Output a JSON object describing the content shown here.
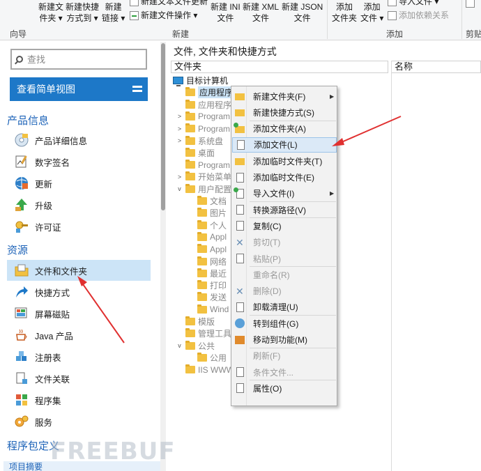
{
  "ribbon": {
    "buttons": [
      {
        "l1": "新建文",
        "l2": "件夹 ▾"
      },
      {
        "l1": "新建快捷",
        "l2": "方式到 ▾"
      },
      {
        "l1": "新建",
        "l2": "链接 ▾"
      },
      {
        "l1": "新建 INI",
        "l2": "文件"
      },
      {
        "l1": "新建 XML",
        "l2": "文件"
      },
      {
        "l1": "新建 JSON",
        "l2": "文件"
      },
      {
        "l1": "添加",
        "l2": "文件夹"
      },
      {
        "l1": "添加",
        "l2": "文件 ▾"
      }
    ],
    "small_top_cut": "新建文本文件更新",
    "new_file_ops": "新建文件操作 ▾",
    "import_file": "导入文件 ▾",
    "add_dependency": "添加依赖关系",
    "group_guide": "向导",
    "group_new": "新建",
    "group_add": "添加",
    "group_clip": "剪贴"
  },
  "sidebar": {
    "search_placeholder": "查找",
    "simple_view": "查看简单视图",
    "section_product": "产品信息",
    "product_items": [
      "产品详细信息",
      "数字签名",
      "更新",
      "升级",
      "许可证"
    ],
    "section_resources": "资源",
    "resource_items": [
      "文件和文件夹",
      "快捷方式",
      "屏幕磁贴",
      "Java 产品",
      "注册表",
      "文件关联",
      "程序集",
      "服务"
    ],
    "section_package": "程序包定义",
    "bottom_item": "项目摘要"
  },
  "main": {
    "title": "文件, 文件夹和快捷方式",
    "col_folder": "文件夹",
    "col_name": "名称",
    "tree": [
      {
        "label": "目标计算机",
        "level": 0,
        "icon": "computer",
        "exp": ""
      },
      {
        "label": "应用程序",
        "level": 1,
        "icon": "folder",
        "exp": "",
        "selected": true
      },
      {
        "label": "应用程序",
        "level": 1,
        "icon": "folder",
        "exp": "",
        "style": "grey"
      },
      {
        "label": "Program",
        "level": 1,
        "icon": "folder",
        "exp": ">",
        "style": "grey"
      },
      {
        "label": "Program",
        "level": 1,
        "icon": "folder",
        "exp": ">",
        "style": "grey"
      },
      {
        "label": "系统盘",
        "level": 1,
        "icon": "folder",
        "exp": ">",
        "style": "grey"
      },
      {
        "label": "桌面",
        "level": 1,
        "icon": "folder",
        "exp": "",
        "style": "grey"
      },
      {
        "label": "Program",
        "level": 1,
        "icon": "folder",
        "exp": "",
        "style": "grey"
      },
      {
        "label": "开始菜单",
        "level": 1,
        "icon": "folder",
        "exp": ">",
        "style": "grey"
      },
      {
        "label": "用户配置",
        "level": 1,
        "icon": "folder",
        "exp": "v",
        "style": "grey"
      },
      {
        "label": "文档",
        "level": 2,
        "icon": "folder",
        "exp": "",
        "style": "grey"
      },
      {
        "label": "图片",
        "level": 2,
        "icon": "folder",
        "exp": "",
        "style": "grey"
      },
      {
        "label": "个人",
        "level": 2,
        "icon": "folder",
        "exp": "",
        "style": "grey"
      },
      {
        "label": "Appl",
        "level": 2,
        "icon": "folder",
        "exp": "",
        "style": "grey"
      },
      {
        "label": "Appl",
        "level": 2,
        "icon": "folder",
        "exp": "",
        "style": "grey"
      },
      {
        "label": "网络",
        "level": 2,
        "icon": "folder",
        "exp": "",
        "style": "grey"
      },
      {
        "label": "最近",
        "level": 2,
        "icon": "folder",
        "exp": "",
        "style": "grey"
      },
      {
        "label": "打印",
        "level": 2,
        "icon": "folder",
        "exp": "",
        "style": "grey"
      },
      {
        "label": "发送",
        "level": 2,
        "icon": "folder",
        "exp": "",
        "style": "grey"
      },
      {
        "label": "Wind",
        "level": 2,
        "icon": "folder",
        "exp": "",
        "style": "grey"
      },
      {
        "label": "模版",
        "level": 1,
        "icon": "folder",
        "exp": "",
        "style": "grey"
      },
      {
        "label": "管理工具",
        "level": 1,
        "icon": "folder",
        "exp": "",
        "style": "grey"
      },
      {
        "label": "公共",
        "level": 1,
        "icon": "folder",
        "exp": "v",
        "style": "grey"
      },
      {
        "label": "公用",
        "level": 2,
        "icon": "folder",
        "exp": "",
        "style": "grey"
      },
      {
        "label": "IIS WWW",
        "level": 1,
        "icon": "folder",
        "exp": "",
        "style": "grey"
      }
    ]
  },
  "context_menu": {
    "items": [
      {
        "label": "新建文件夹(F)",
        "icon": "folder",
        "submenu": true
      },
      {
        "label": "新建快捷方式(S)",
        "icon": "folder"
      },
      {
        "label": "添加文件夹(A)",
        "icon": "folder-plus",
        "sep_before": true
      },
      {
        "label": "添加文件(L)",
        "icon": "page",
        "highlight": true
      },
      {
        "label": "添加临时文件夹(T)",
        "icon": "folder"
      },
      {
        "label": "添加临时文件(E)",
        "icon": "page"
      },
      {
        "label": "导入文件(I)",
        "icon": "page-plus",
        "submenu": true
      },
      {
        "label": "转换源路径(V)",
        "icon": "page",
        "sep_before": true
      },
      {
        "label": "复制(C)",
        "icon": "page",
        "sep_before": true
      },
      {
        "label": "剪切(T)",
        "icon": "x",
        "disabled": true
      },
      {
        "label": "粘贴(P)",
        "icon": "page",
        "disabled": true
      },
      {
        "label": "重命名(R)",
        "icon": "none",
        "disabled": true,
        "sep_before": true
      },
      {
        "label": "删除(D)",
        "icon": "x",
        "disabled": true
      },
      {
        "label": "卸载清理(U)",
        "icon": "page"
      },
      {
        "label": "转到组件(G)",
        "icon": "gear",
        "sep_before": true
      },
      {
        "label": "移动到功能(M)",
        "icon": "box"
      },
      {
        "label": "刷新(F)",
        "icon": "none",
        "disabled": true,
        "sep_before": true
      },
      {
        "label": "条件文件...",
        "icon": "page",
        "disabled": true
      },
      {
        "label": "属性(O)",
        "icon": "page",
        "sep_before": true
      }
    ]
  },
  "watermark": "FREEBUF",
  "colors": {
    "accent": "#1d78c8",
    "section": "#1d63b8",
    "arrow": "#e03030",
    "selection": "#cce4f7"
  }
}
